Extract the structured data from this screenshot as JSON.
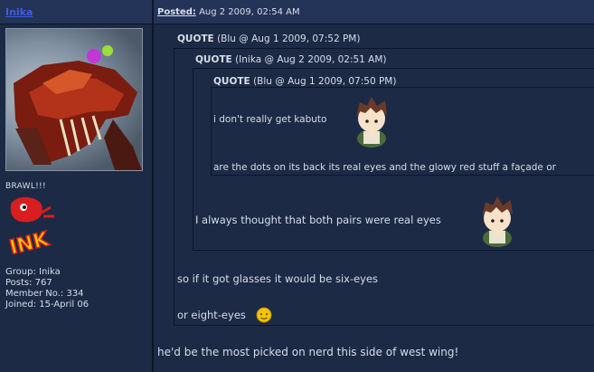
{
  "post": {
    "author": "Inika",
    "posted_label": "Posted:",
    "posted_date": "Aug 2 2009, 02:54 AM",
    "reply": "he'd be the most picked on nerd this side of west wing!"
  },
  "user": {
    "avatar_caption": "BRAWL!!!",
    "logo_text": "INK",
    "group": "Group: Inika",
    "posts": "Posts: 767",
    "member_no": "Member No.: 334",
    "joined": "Joined: 15-April 06"
  },
  "quote1": {
    "label": "QUOTE",
    "meta": "(Blu @ Aug 1 2009, 07:52 PM)",
    "line1": "so if it got glasses it would be six-eyes",
    "line2": "or eight-eyes"
  },
  "quote2": {
    "label": "QUOTE",
    "meta": "(Inika @ Aug 2 2009, 02:51 AM)",
    "line1": "I always thought that both pairs were real eyes"
  },
  "quote3": {
    "label": "QUOTE",
    "meta": "(Blu @ Aug 1 2009, 07:50 PM)",
    "line1": "i don't really get kabuto",
    "line2": "are the dots on its back its real eyes and the glowy red stuff a façade or"
  },
  "colors": {
    "background": "#1c2a46",
    "header": "#243458",
    "username": "#3b5fe0"
  },
  "icons": [
    "chibi-boy-emote",
    "chibi-boy-emote",
    "smiley-icon"
  ]
}
